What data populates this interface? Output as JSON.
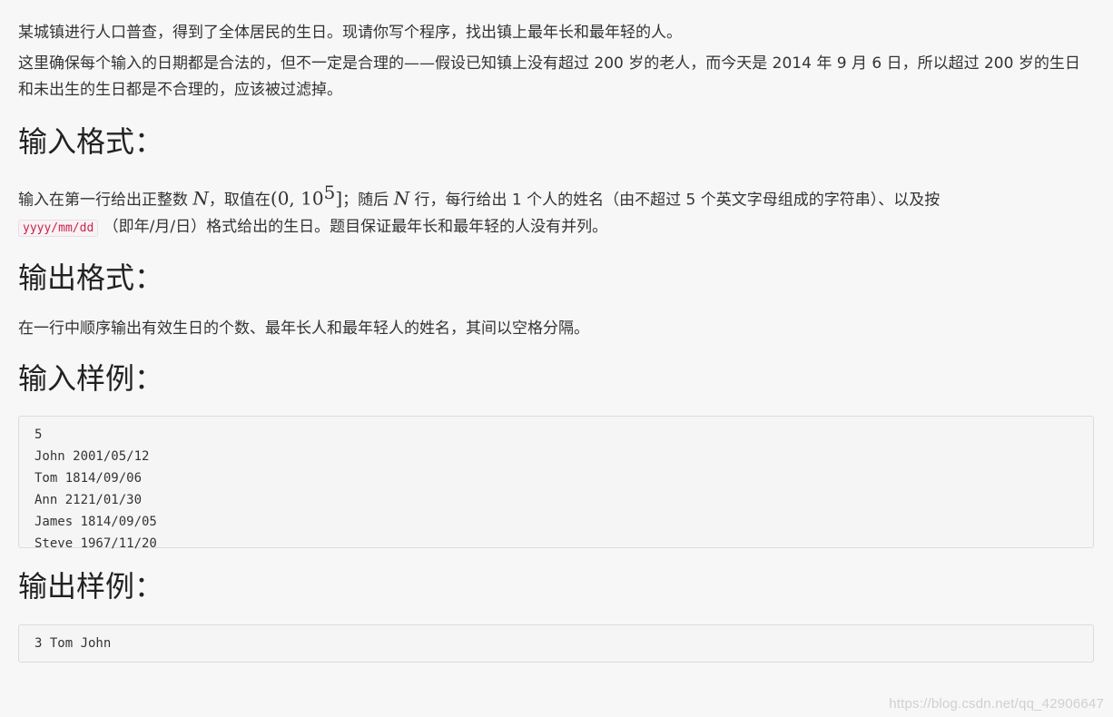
{
  "intro": {
    "p1": "某城镇进行人口普查，得到了全体居民的生日。现请你写个程序，找出镇上最年长和最年轻的人。",
    "p2": "这里确保每个输入的日期都是合法的，但不一定是合理的——假设已知镇上没有超过 200 岁的老人，而今天是 2014 年 9 月 6 日，所以超过 200 岁的生日和未出生的生日都是不合理的，应该被过滤掉。"
  },
  "input_format": {
    "heading": "输入格式：",
    "t1": "输入在第一行给出正整数 ",
    "var_n": "N",
    "t2": "，取值在",
    "range_open": "(0, 10",
    "range_exp": "5",
    "range_close": "]",
    "t3": "；随后 ",
    "var_n2": "N",
    "t4": " 行，每行给出 1 个人的姓名（由不超过 5 个英文字母组成的字符串）、以及按 ",
    "code": "yyyy/mm/dd",
    "t5": " （即年/月/日）格式给出的生日。题目保证最年长和最年轻的人没有并列。"
  },
  "output_format": {
    "heading": "输出格式：",
    "text": "在一行中顺序输出有效生日的个数、最年长人和最年轻人的姓名，其间以空格分隔。"
  },
  "sample_input": {
    "heading": "输入样例：",
    "code": "5\nJohn 2001/05/12\nTom 1814/09/06\nAnn 2121/01/30\nJames 1814/09/05\nSteve 1967/11/20"
  },
  "sample_output": {
    "heading": "输出样例：",
    "code": "3 Tom John"
  },
  "watermark": "https://blog.csdn.net/qq_42906647"
}
